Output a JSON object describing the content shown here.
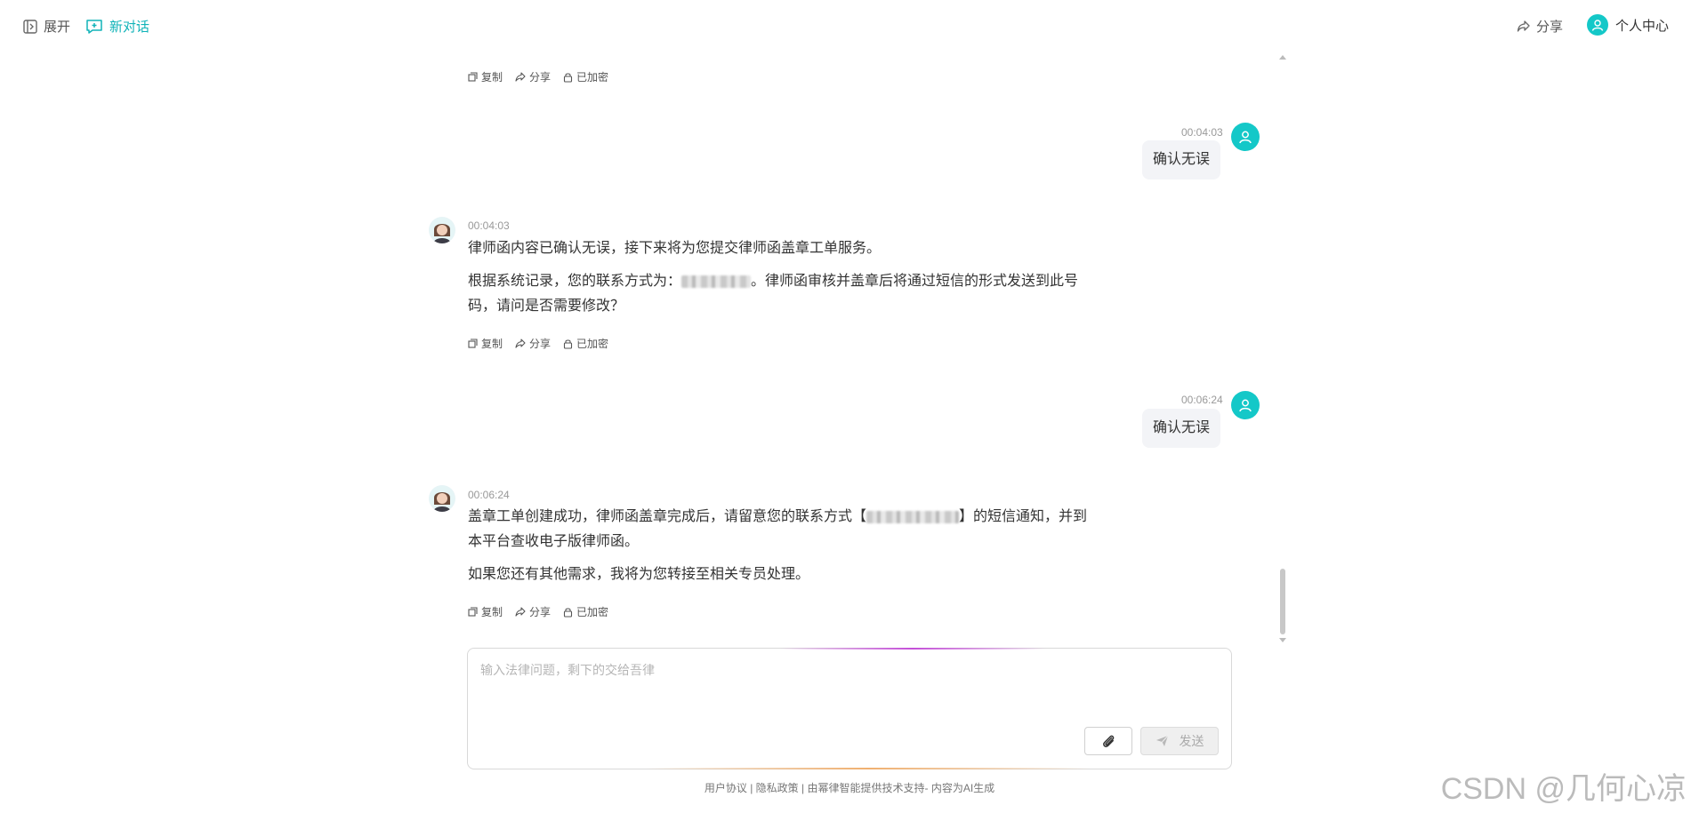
{
  "topbar": {
    "expand_label": "展开",
    "new_chat_label": "新对话",
    "share_label": "分享",
    "profile_label": "个人中心"
  },
  "actions": {
    "copy": "复制",
    "share": "分享",
    "encrypted": "已加密"
  },
  "messages": [
    {
      "role": "user",
      "time": "00:04:03",
      "text": "确认无误"
    },
    {
      "role": "assistant",
      "time": "00:04:03",
      "paragraphs": [
        "律师函内容已确认无误，接下来将为您提交律师函盖章工单服务。",
        "根据系统记录，您的联系方式为：",
        "。律师函审核并盖章后将通过短信的形式发送到此号码，请问是否需要修改？"
      ]
    },
    {
      "role": "user",
      "time": "00:06:24",
      "text": "确认无误"
    },
    {
      "role": "assistant",
      "time": "00:06:24",
      "paragraphs": [
        "盖章工单创建成功，律师函盖章完成后，请留意您的联系方式【",
        "】的短信通知，并到本平台查收电子版律师函。",
        "如果您还有其他需求，我将为您转接至相关专员处理。"
      ]
    }
  ],
  "composer": {
    "placeholder": "输入法律问题，剩下的交给吾律",
    "send_label": "发送"
  },
  "footer": {
    "user_agreement": "用户协议",
    "privacy_policy": "隐私政策",
    "sep": "|",
    "powered_by": "由幂律智能提供技术支持",
    "ai_note": "- 内容为AI生成"
  },
  "watermark": "CSDN @几何心凉",
  "colors": {
    "accent": "#14c8c8",
    "bubble": "#f3f4f7"
  }
}
